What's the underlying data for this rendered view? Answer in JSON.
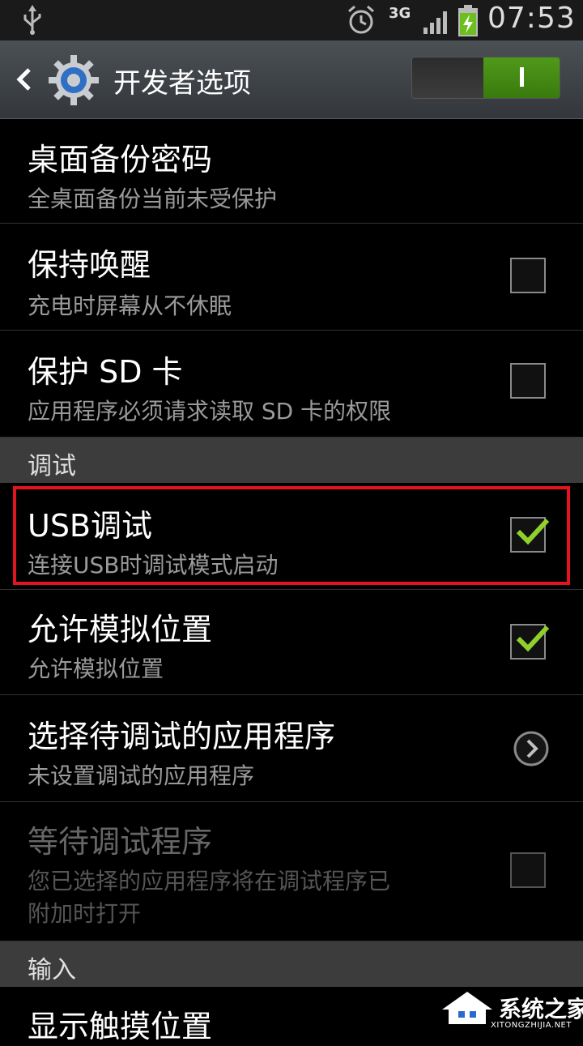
{
  "status_bar": {
    "network_type": "3G",
    "time": "07:53",
    "icons": [
      "usb-icon",
      "alarm-icon",
      "signal-icon",
      "battery-charging-icon"
    ]
  },
  "action_bar": {
    "back_icon": "chevron-left-icon",
    "app_icon": "gear-icon",
    "title": "开发者选项",
    "master_switch": {
      "state": "on",
      "on_color": "#4f9a1a"
    }
  },
  "items": {
    "desktop_backup_password": {
      "title": "桌面备份密码",
      "summary": "全桌面备份当前未受保护"
    },
    "stay_awake": {
      "title": "保持唤醒",
      "summary": "充电时屏幕从不休眠",
      "checked": false
    },
    "protect_sd": {
      "title": "保护 SD 卡",
      "summary": "应用程序必须请求读取 SD 卡的权限",
      "checked": false
    },
    "usb_debugging": {
      "title": "USB调试",
      "summary": "连接USB时调试模式启动",
      "checked": true
    },
    "mock_locations": {
      "title": "允许模拟位置",
      "summary": "允许模拟位置",
      "checked": true
    },
    "select_debug_app": {
      "title": "选择待调试的应用程序",
      "summary": "未设置调试的应用程序"
    },
    "wait_for_debugger": {
      "title": "等待调试程序",
      "summary_line1": "您已选择的应用程序将在调试程序已",
      "summary_line2": "附加时打开",
      "checked": false,
      "enabled": false
    },
    "show_touches": {
      "title": "显示触摸位置"
    }
  },
  "sections": {
    "debug": "调试",
    "input": "输入"
  },
  "colors": {
    "check_mark": "#8fd12a",
    "highlight_border": "#e4141e",
    "section_background": "#3c3c3c"
  },
  "watermark": {
    "text": "系统之家",
    "url": "XITONGZHIJIA.NET"
  }
}
